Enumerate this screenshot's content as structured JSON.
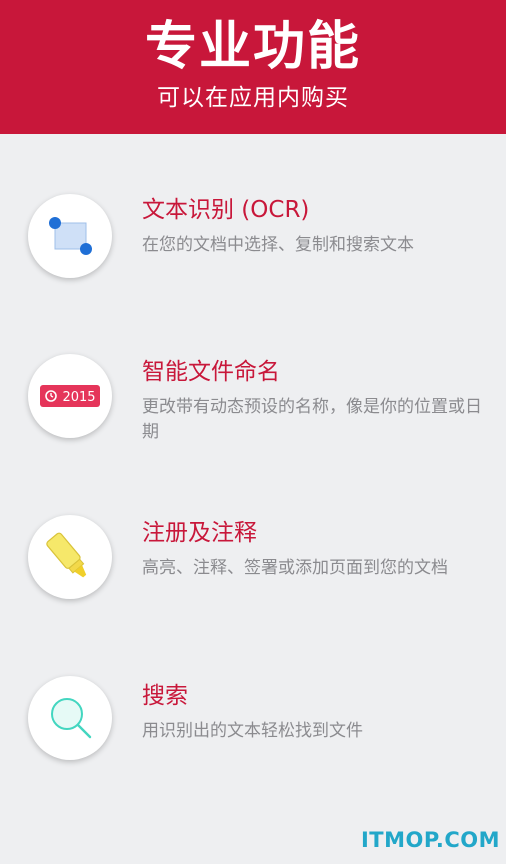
{
  "header": {
    "title": "专业功能",
    "subtitle": "可以在应用内购买"
  },
  "features": [
    {
      "icon": "ocr-selection-icon",
      "title": "文本识别 (OCR)",
      "description": "在您的文档中选择、复制和搜索文本"
    },
    {
      "icon": "calendar-date-icon",
      "badge": "2015",
      "title": "智能文件命名",
      "description": "更改带有动态预设的名称，像是你的位置或日期"
    },
    {
      "icon": "highlighter-icon",
      "title": "注册及注释",
      "description": "高亮、注释、签署或添加页面到您的文档"
    },
    {
      "icon": "search-icon",
      "title": "搜索",
      "description": "用识别出的文本轻松找到文件"
    }
  ],
  "watermark": "ITMOP.COM",
  "colors": {
    "brand": "#c8173a",
    "ocr_blue": "#1f6fd6",
    "highlighter_yellow": "#f6e86a",
    "search_teal": "#43d6c0"
  }
}
